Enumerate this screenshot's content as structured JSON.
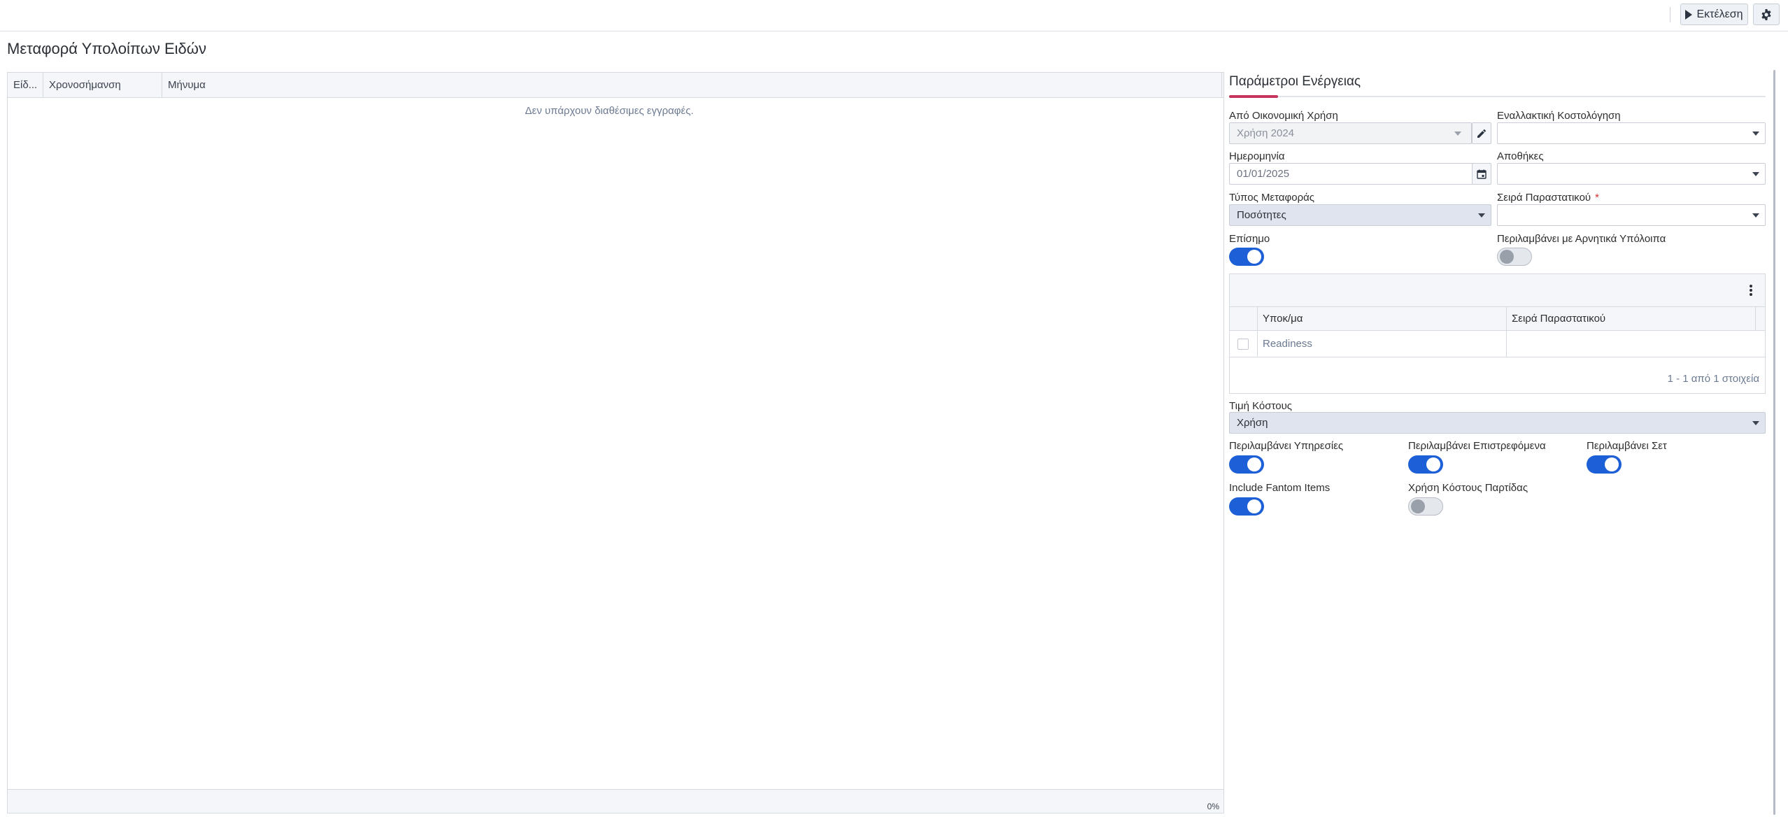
{
  "toolbar": {
    "run_label": "Εκτέλεση",
    "run_icon": "play-icon",
    "settings_icon": "gear-icon"
  },
  "page": {
    "title": "Μεταφορά Υπολοίπων Ειδών"
  },
  "log_grid": {
    "columns": [
      "Είδ...",
      "Χρονοσήμανση",
      "Μήνυμα"
    ],
    "empty_message": "Δεν υπάρχουν διαθέσιμες εγγραφές.",
    "progress": "0%"
  },
  "params": {
    "title": "Παράμετροι Ενέργειας",
    "from_fiscal_year": {
      "label": "Από Οικονομική Χρήση",
      "value": "Χρήση 2024"
    },
    "alt_costing": {
      "label": "Εναλλακτική Κοστολόγηση",
      "value": ""
    },
    "date": {
      "label": "Ημερομηνία",
      "value": "01/01/2025"
    },
    "warehouses": {
      "label": "Αποθήκες",
      "value": ""
    },
    "transfer_type": {
      "label": "Τύπος Μεταφοράς",
      "value": "Ποσότητες"
    },
    "doc_series": {
      "label": "Σειρά Παραστατικού",
      "required_mark": "*",
      "value": ""
    },
    "official": {
      "label": "Επίσημο",
      "on": true
    },
    "include_negative": {
      "label": "Περιλαμβάνει με Αρνητικά Υπόλοιπα",
      "on": false
    },
    "branch_table": {
      "columns": [
        "Υποκ/μα",
        "Σειρά Παραστατικού"
      ],
      "rows": [
        {
          "branch": "Readiness",
          "series": ""
        }
      ],
      "footer": "1 - 1 από 1 στοιχεία"
    },
    "cost_value": {
      "label": "Τιμή Κόστους",
      "value": "Χρήση"
    },
    "include_services": {
      "label": "Περιλαμβάνει Υπηρεσίες",
      "on": true
    },
    "include_returnables": {
      "label": "Περιλαμβάνει Επιστρεφόμενα",
      "on": true
    },
    "include_sets": {
      "label": "Περιλαμβάνει Σετ",
      "on": true
    },
    "include_fantom": {
      "label": "Include Fantom Items",
      "on": true
    },
    "batch_cost": {
      "label": "Χρήση Κόστους Παρτίδας",
      "on": false
    }
  },
  "colors": {
    "accent": "#c7355e",
    "toggle_on": "#1d5fd6"
  }
}
